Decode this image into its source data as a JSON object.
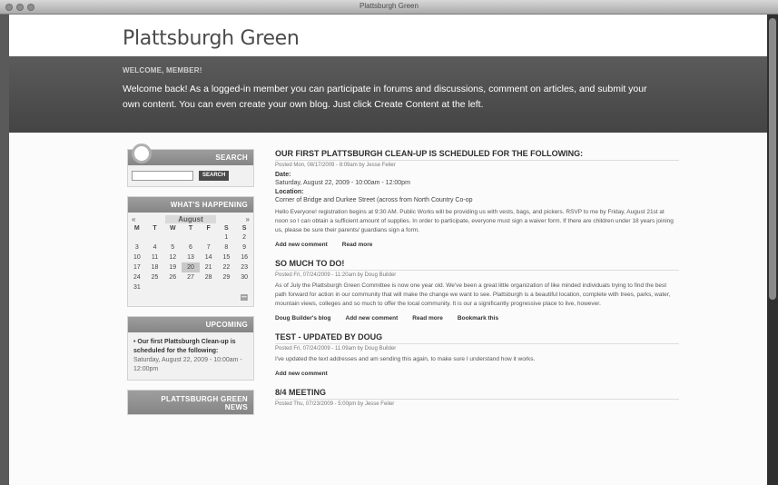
{
  "window": {
    "title": "Plattsburgh Green"
  },
  "site": {
    "title": "Plattsburgh Green"
  },
  "welcome": {
    "label": "WELCOME, MEMBER!",
    "text": "Welcome back! As a logged-in member you can participate in forums and discussions, comment on articles, and submit your own content. You can even create your own blog. Just click Create Content at the left."
  },
  "sidebar": {
    "search": {
      "heading": "SEARCH",
      "button": "SEARCH",
      "placeholder": ""
    },
    "calendar": {
      "heading": "WHAT'S HAPPENING",
      "prev": "«",
      "next": "»",
      "month": "August",
      "weekdays": [
        "M",
        "T",
        "W",
        "T",
        "F",
        "S",
        "S"
      ],
      "weeks": [
        [
          "",
          "",
          "",
          "",
          "",
          "1",
          "2"
        ],
        [
          "3",
          "4",
          "5",
          "6",
          "7",
          "8",
          "9"
        ],
        [
          "10",
          "11",
          "12",
          "13",
          "14",
          "15",
          "16"
        ],
        [
          "17",
          "18",
          "19",
          "20",
          "21",
          "22",
          "23"
        ],
        [
          "24",
          "25",
          "26",
          "27",
          "28",
          "29",
          "30"
        ],
        [
          "31",
          "",
          "",
          "",
          "",
          "",
          ""
        ]
      ],
      "today": "20"
    },
    "upcoming": {
      "heading": "UPCOMING",
      "event": "Our first Plattsburgh Clean-up is scheduled for the following:",
      "date": "Saturday, August 22, 2009 - 10:00am - 12:00pm"
    },
    "news": {
      "heading_line1": "PLATTSBURGH GREEN",
      "heading_line2": "NEWS"
    }
  },
  "posts": [
    {
      "title": "OUR FIRST PLATTSBURGH CLEAN-UP IS SCHEDULED FOR THE FOLLOWING:",
      "meta": "Posted Mon, 08/17/2009 - 8:09am by Jesse Feiler",
      "date_label": "Date:",
      "date_value": "Saturday, August 22, 2009 - 10:00am - 12:00pm",
      "location_label": "Location:",
      "location_value": "Corner of Bridge and Durkee Street (across from North Country Co-op",
      "body": "Hello Everyone! registration begins at 9:30 AM. Public Works will be providing us with vests, bags, and pickers. RSVP to me by Friday, August 21st at noon so I can obtain a sufficient amount of supplies. In order to participate, everyone must sign a waiver form. If there are children under 18 years joining us, please be sure their parents/ guardians sign a form.",
      "links": [
        "Add new comment",
        "Read more"
      ]
    },
    {
      "title": "SO MUCH TO DO!",
      "meta": "Posted Fri, 07/24/2009 - 11:20am by Doug Builder",
      "body": "As of July the Plattsburgh Green Committee is now one year old. We've been a great little organization of like minded individuals trying to find the best path forward for action in our community that will make the change we want to see. Plattsburgh is a beautiful location, complete with trees, parks, water, mountain views, colleges and so much to offer the local community. It is our a significantly progressive place to live, however.",
      "links": [
        "Doug Builder's blog",
        "Add new comment",
        "Read more",
        "Bookmark this"
      ]
    },
    {
      "title": "TEST - UPDATED BY DOUG",
      "meta": "Posted Fri, 07/24/2009 - 11:09am by Doug Builder",
      "body": "I've updated the text addresses and am sending this again, to make sure I understand how it works.",
      "links": [
        "Add new comment"
      ]
    },
    {
      "title": "8/4 MEETING",
      "meta": "Posted Thu, 07/23/2009 - 5:00pm by Jesse Feiler"
    }
  ]
}
